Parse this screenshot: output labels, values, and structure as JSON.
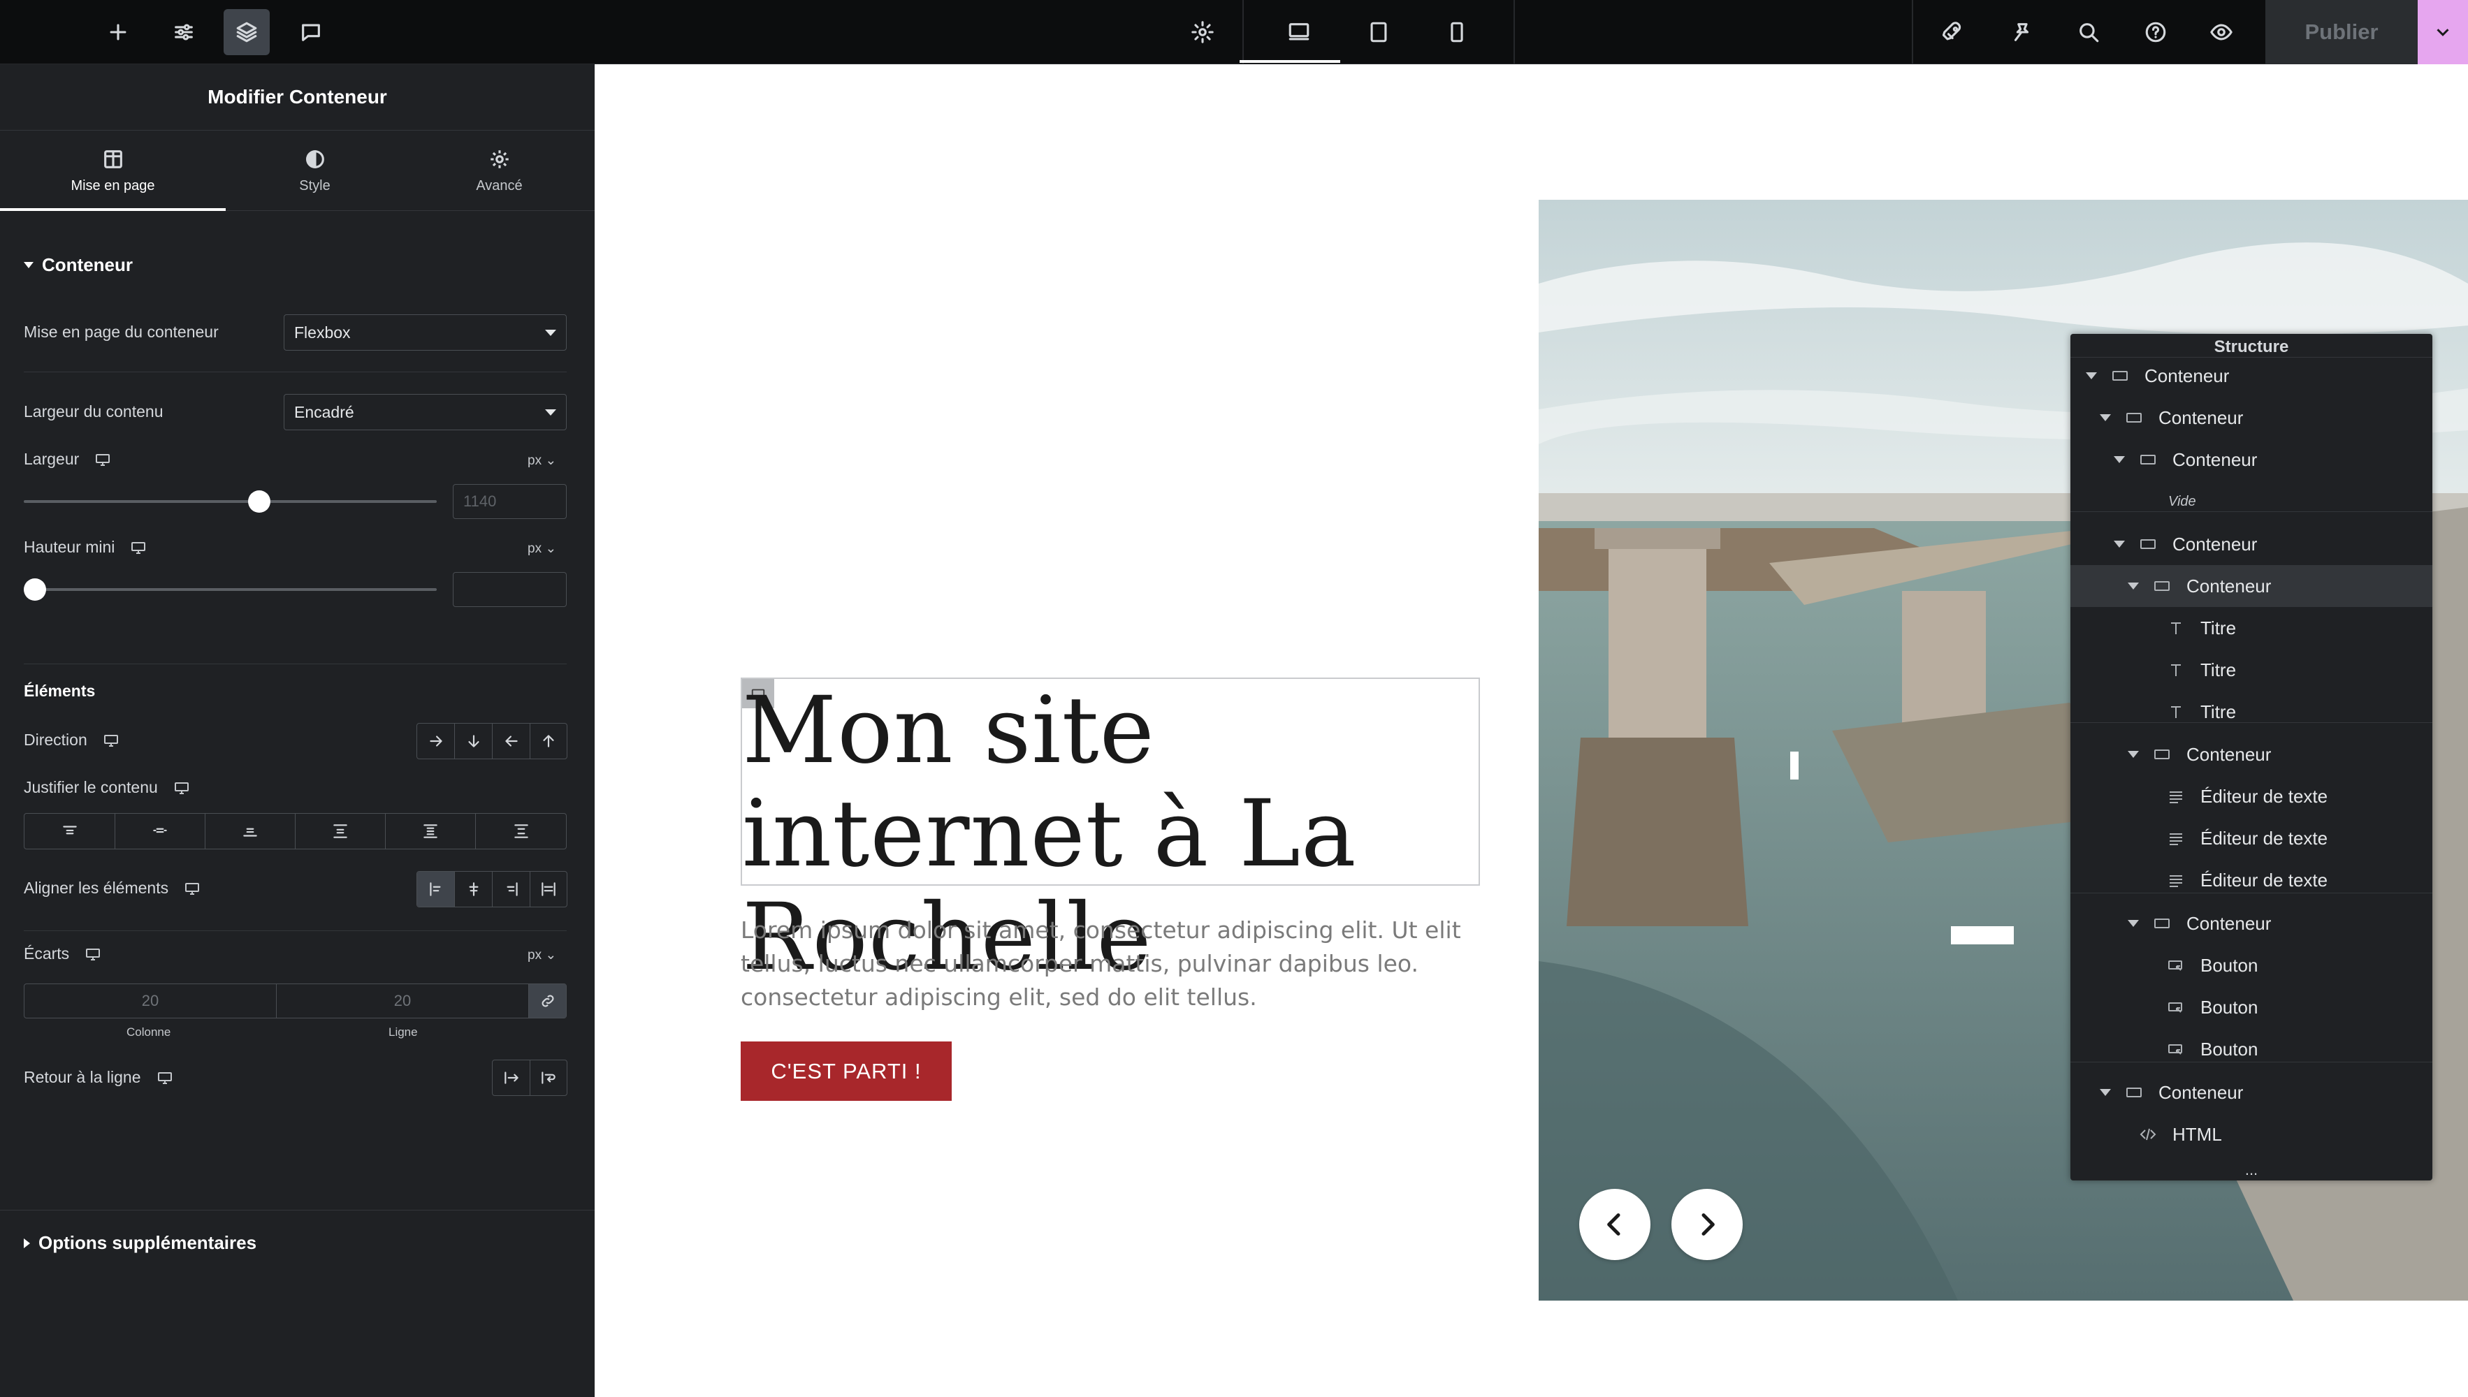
{
  "topbar": {
    "left_icons": [
      "plus-icon",
      "sliders-icon",
      "layers-icon",
      "comment-icon"
    ],
    "center_icons": [
      "gear-icon",
      "desktop-icon",
      "tablet-icon",
      "mobile-icon"
    ],
    "right_icons": [
      "rocket-icon",
      "pin-icon",
      "search-icon",
      "help-icon",
      "eye-icon"
    ],
    "publish_label": "Publier",
    "colors": {
      "bg": "#0c0d0e",
      "publish_more": "#e6a6ef"
    }
  },
  "panel": {
    "title": "Modifier Conteneur",
    "tabs": [
      {
        "label": "Mise en page",
        "icon": "layout-icon"
      },
      {
        "label": "Style",
        "icon": "contrast-icon"
      },
      {
        "label": "Avancé",
        "icon": "gear-icon"
      }
    ],
    "section_container": "Conteneur",
    "layout_label": "Mise en page du conteneur",
    "layout_value": "Flexbox",
    "content_width_label": "Largeur du contenu",
    "content_width_value": "Encadré",
    "width_label": "Largeur",
    "width_unit": "px",
    "width_placeholder": "1140",
    "width_level": 0.57,
    "min_height_label": "Hauteur mini",
    "min_height_unit": "px",
    "min_height_level": 0,
    "section_elements": "Éléments",
    "direction_label": "Direction",
    "justify_label": "Justifier le contenu",
    "align_label": "Aligner les éléments",
    "gaps_label": "Écarts",
    "gaps_unit": "px",
    "gap_column": "20",
    "gap_row": "20",
    "gap_column_label": "Colonne",
    "gap_row_label": "Ligne",
    "wrap_label": "Retour à la ligne",
    "extra_options": "Options supplémentaires"
  },
  "hero": {
    "title": "Mon site internet à La Rochelle",
    "text": "Lorem ipsum dolor sit amet, consectetur adipiscing elit. Ut elit tellus, luctus nec ullamcorper mattis, pulvinar dapibus leo. consectetur adipiscing elit, sed do elit tellus.",
    "cta": "C'EST PARTI !",
    "cta_color": "#a8272b"
  },
  "structure": {
    "title": "Structure",
    "items": [
      {
        "label": "Conteneur",
        "type": "container"
      },
      {
        "label": "Conteneur",
        "type": "container"
      },
      {
        "label": "Conteneur",
        "type": "container"
      },
      {
        "label": "Vide",
        "type": "empty"
      },
      {
        "label": "Conteneur",
        "type": "container"
      },
      {
        "label": "Conteneur",
        "type": "container"
      },
      {
        "label": "Titre",
        "type": "heading"
      },
      {
        "label": "Titre",
        "type": "heading"
      },
      {
        "label": "Titre",
        "type": "heading"
      },
      {
        "label": "Conteneur",
        "type": "container"
      },
      {
        "label": "Éditeur de texte",
        "type": "text"
      },
      {
        "label": "Éditeur de texte",
        "type": "text"
      },
      {
        "label": "Éditeur de texte",
        "type": "text"
      },
      {
        "label": "Conteneur",
        "type": "container"
      },
      {
        "label": "Bouton",
        "type": "button"
      },
      {
        "label": "Bouton",
        "type": "button"
      },
      {
        "label": "Bouton",
        "type": "button"
      },
      {
        "label": "Conteneur",
        "type": "container"
      },
      {
        "label": "HTML",
        "type": "html"
      }
    ],
    "more": "..."
  }
}
